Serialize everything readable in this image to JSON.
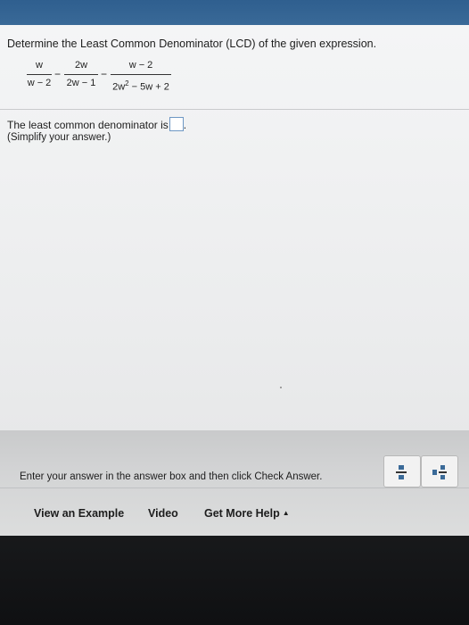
{
  "question": {
    "title": "Determine the Least Common Denominator (LCD) of the given expression.",
    "expression": {
      "fractions": [
        {
          "numerator": "w",
          "denominator": "w − 2"
        },
        {
          "numerator": "2w",
          "denominator": "2w − 1"
        },
        {
          "numerator": "w − 2",
          "denominator_base": "2w",
          "denominator_exp": "2",
          "denominator_rest": " − 5w + 2"
        }
      ],
      "operators": [
        "−",
        "−"
      ]
    },
    "prompt": "The least common denominator is",
    "prompt_end": ".",
    "hint": "(Simplify your answer.)"
  },
  "footer": {
    "instructions": "Enter your answer in the answer box and then click Check Answer.",
    "actions": {
      "view_example": "View an Example",
      "video": "Video",
      "get_more_help": "Get More Help",
      "caret": "▲"
    },
    "tool_icons": [
      "fraction-template-icon",
      "mixed-number-template-icon"
    ]
  },
  "colors": {
    "accent_blue": "#3a6a98",
    "answer_box_border": "#6e97c4"
  }
}
